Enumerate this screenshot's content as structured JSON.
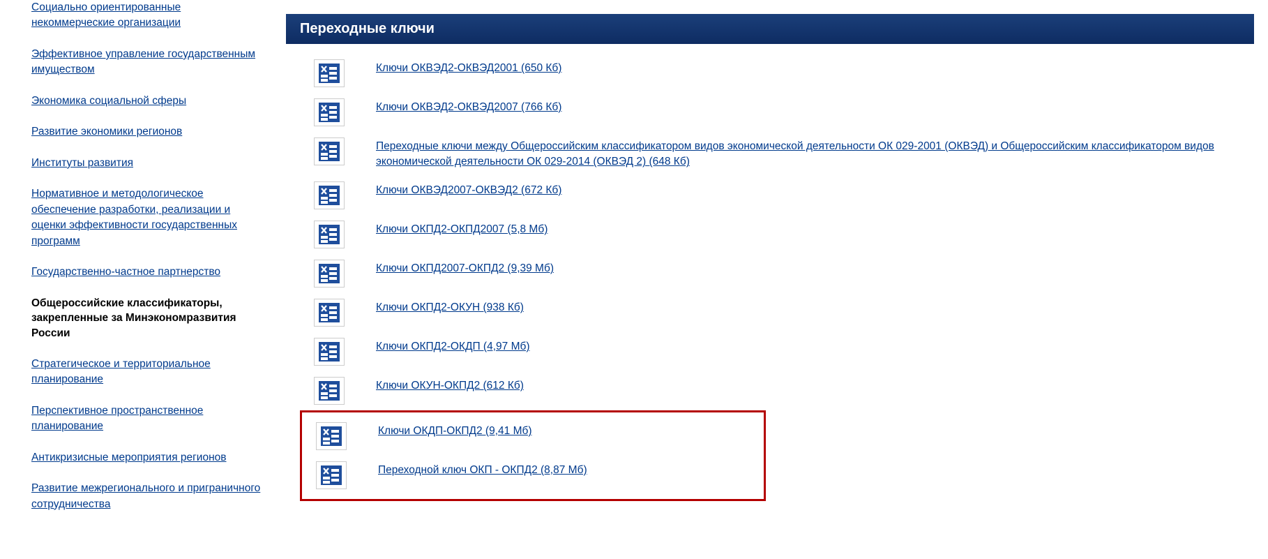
{
  "sidebar": {
    "items": [
      {
        "label": "Социально ориентированные некоммерческие организации",
        "active": false
      },
      {
        "label": "Эффективное управление государственным имуществом",
        "active": false
      },
      {
        "label": "Экономика социальной сферы",
        "active": false
      },
      {
        "label": "Развитие экономики регионов",
        "active": false
      },
      {
        "label": "Институты развития",
        "active": false
      },
      {
        "label": "Нормативное и методологическое обеспечение разработки, реализации и оценки эффективности государственных программ",
        "active": false
      },
      {
        "label": "Государственно-частное партнерство",
        "active": false
      },
      {
        "label": "Общероссийские классификаторы, закрепленные за Минэкономразвития России",
        "active": true
      },
      {
        "label": "Стратегическое и территориальное планирование",
        "active": false
      },
      {
        "label": "Перспективное пространственное планирование",
        "active": false
      },
      {
        "label": "Антикризисные мероприятия регионов",
        "active": false
      },
      {
        "label": "Развитие межрегионального и приграничного сотрудничества",
        "active": false
      }
    ]
  },
  "main": {
    "header": "Переходные ключи",
    "files": [
      {
        "label": "Ключи ОКВЭД2-ОКВЭД2001 (650 Кб)",
        "highlighted": false
      },
      {
        "label": "Ключи ОКВЭД2-ОКВЭД2007 (766 Кб)",
        "highlighted": false
      },
      {
        "label": "Переходные ключи между Общероссийским классификатором видов экономической деятельности ОК 029-2001 (ОКВЭД) и Общероссийским классификатором видов экономической деятельности ОК 029-2014 (ОКВЭД 2) (648 Кб)",
        "highlighted": false
      },
      {
        "label": "Ключи ОКВЭД2007-ОКВЭД2 (672 Кб)",
        "highlighted": false
      },
      {
        "label": "Ключи ОКПД2-ОКПД2007 (5,8 Мб)",
        "highlighted": false
      },
      {
        "label": "Ключи ОКПД2007-ОКПД2 (9,39 Мб)",
        "highlighted": false
      },
      {
        "label": "Ключи ОКПД2-ОКУН (938 Кб)",
        "highlighted": false
      },
      {
        "label": "Ключи ОКПД2-ОКДП (4,97 Мб)",
        "highlighted": false
      },
      {
        "label": "Ключи ОКУН-ОКПД2 (612 Кб)",
        "highlighted": false
      },
      {
        "label": "Ключи ОКДП-ОКПД2 (9,41 Мб)",
        "highlighted": true
      },
      {
        "label": "Переходной ключ ОКП - ОКПД2 (8,87 Мб)",
        "highlighted": true
      }
    ]
  }
}
